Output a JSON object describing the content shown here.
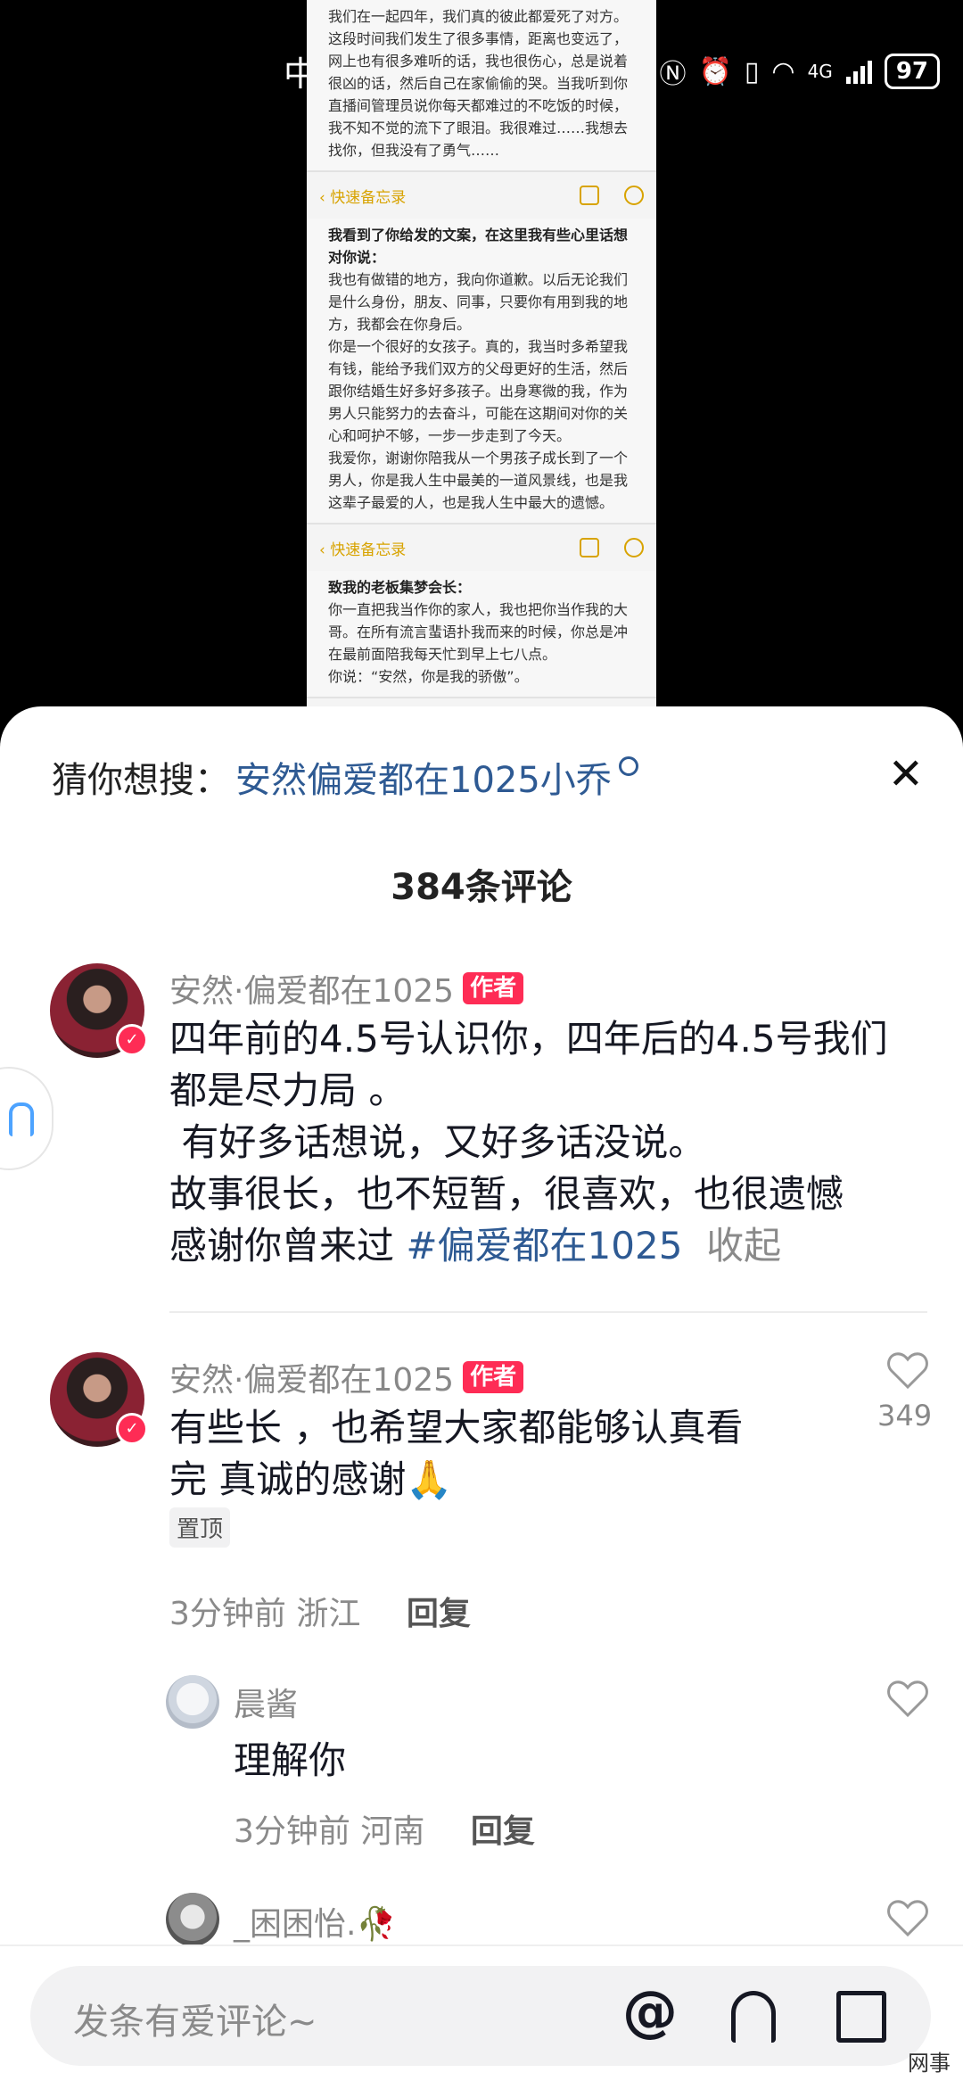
{
  "status_bar": {
    "carrier_fragment": "中",
    "network": "4G",
    "battery": "97"
  },
  "memo": {
    "top_text": "我们在一起四年，我们真的彼此都爱死了对方。\n这段时间我们发生了很多事情，距离也变远了，网上也有很多难听的话，我也很伤心，总是说着很凶的话，然后自己在家偷偷的哭。当我听到你直播间管理员说你每天都难过的不吃饭的时候，我不知不觉的流下了眼泪。我很难过……我想去找你，但我没有了勇气……",
    "bar_label_1": "快速备忘录",
    "heading_2": "我看到了你给发的文案，在这里我有些心里话想对你说：",
    "body_2": "我也有做错的地方，我向你道歉。以后无论我们是什么身份，朋友、同事，只要你有用到我的地方，我都会在你身后。\n你是一个很好的女孩子。真的，我当时多希望我有钱，能给予我们双方的父母更好的生活，然后跟你结婚生好多好多孩子。出身寒微的我，作为男人只能努力的去奋斗，可能在这期间对你的关心和呵护不够，一步一步走到了今天。\n我爱你，谢谢你陪我从一个男孩子成长到了一个男人，你是我人生中最美的一道风景线，也是我这辈子最爱的人，也是我人生中最大的遗憾。",
    "bar_label_2": "快速备忘录",
    "heading_3": "致我的老板集梦会长：",
    "body_3": "你一直把我当作你的家人，我也把你当作我的大哥。在所有流言蜚语扑我而来的时候，你总是冲在最前面陪我每天忙到早上七八点。\n你说：“安然，你是我的骄傲”。"
  },
  "sheet": {
    "suggest_prefix": "猜你想搜：",
    "suggest_query": "安然偏爱都在1025小乔",
    "comment_count": "384条评论"
  },
  "comments": [
    {
      "username": "安然·偏爱都在1025",
      "tag": "作者",
      "text": "四年前的4.5号认识你，四年后的4.5号我们都是尽力局 。\n 有好多话想说，又好多话没说。\n故事很长，也不短暂，很喜欢，也很遗憾\n感谢你曾来过 ",
      "hashtag": "#偏爱都在1025",
      "collapse": "收起"
    },
    {
      "username": "安然·偏爱都在1025",
      "tag": "作者",
      "text": "有些长 ，也希望大家都能够认真看\n完 真诚的感谢🙏",
      "pinned": "置顶",
      "time": "3分钟前",
      "location": "浙江",
      "reply": "回复",
      "likes": "349"
    }
  ],
  "replies": [
    {
      "username": "晨酱",
      "text": "理解你",
      "time": "3分钟前",
      "location": "河南",
      "reply": "回复"
    },
    {
      "username": "_困困怡.🥀"
    }
  ],
  "input_bar": {
    "placeholder": "发条有爱评论~",
    "at_symbol": "@"
  },
  "watermark": "网事",
  "colors": {
    "accent_red": "#fe2c55",
    "link_blue": "#2e5a93",
    "memo_yellow": "#d8a300"
  }
}
